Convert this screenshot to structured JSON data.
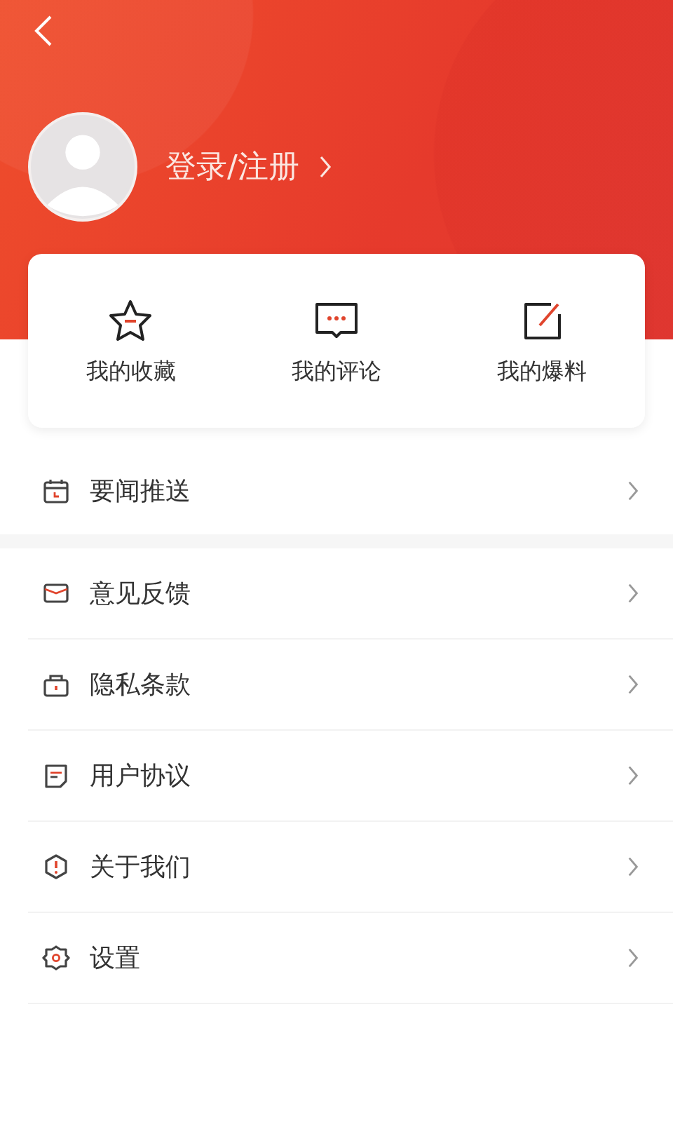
{
  "header": {
    "login_label": "登录/注册"
  },
  "shortcuts": [
    {
      "kind": "star",
      "label": "我的收藏"
    },
    {
      "kind": "comment",
      "label": "我的评论"
    },
    {
      "kind": "edit",
      "label": "我的爆料"
    }
  ],
  "menu_groups": [
    [
      {
        "kind": "calendar",
        "label": "要闻推送"
      }
    ],
    [
      {
        "kind": "mail",
        "label": "意见反馈"
      },
      {
        "kind": "lock",
        "label": "隐私条款"
      },
      {
        "kind": "doc",
        "label": "用户协议"
      },
      {
        "kind": "alert",
        "label": "关于我们"
      },
      {
        "kind": "gear",
        "label": "设置"
      }
    ]
  ]
}
